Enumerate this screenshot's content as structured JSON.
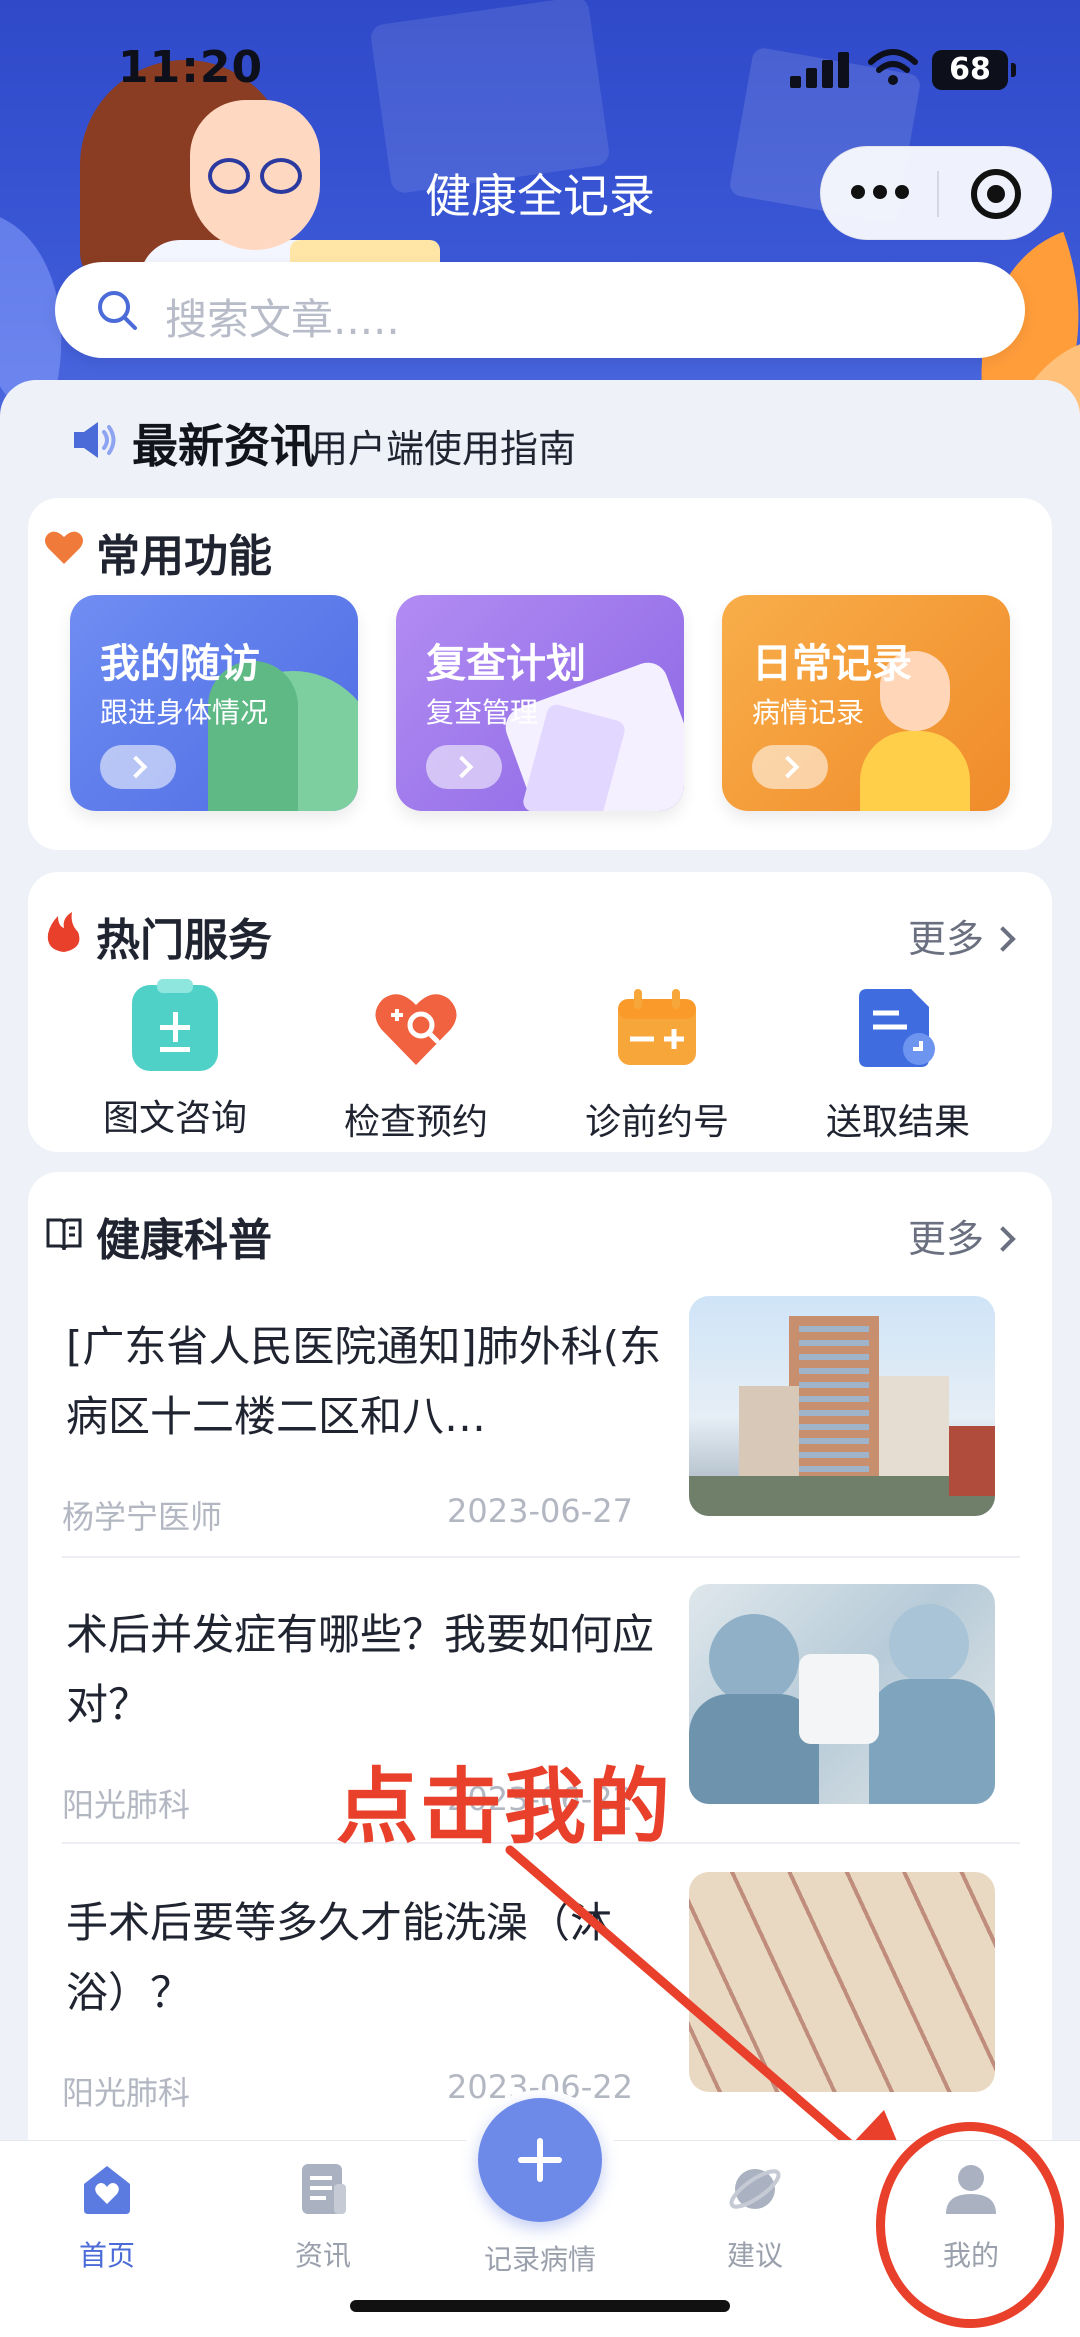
{
  "status": {
    "time": "11:20",
    "battery": "68"
  },
  "header": {
    "title": "健康全记录",
    "search_placeholder": "搜索文章....."
  },
  "news": {
    "label": "最新资讯",
    "text": "用户端使用指南"
  },
  "common": {
    "title": "常用功能",
    "tiles": [
      {
        "title": "我的随访",
        "sub": "跟进身体情况"
      },
      {
        "title": "复查计划",
        "sub": "复查管理"
      },
      {
        "title": "日常记录",
        "sub": "病情记录"
      }
    ]
  },
  "hot": {
    "title": "热门服务",
    "more": "更多",
    "items": [
      {
        "label": "图文咨询"
      },
      {
        "label": "检查预约"
      },
      {
        "label": "诊前约号"
      },
      {
        "label": "送取结果"
      }
    ]
  },
  "science": {
    "title": "健康科普",
    "more": "更多",
    "articles": [
      {
        "title": "[广东省人民医院通知]肺外科(东病区十二楼二区和八…",
        "author": "杨学宁医师",
        "date": "2023-06-27"
      },
      {
        "title": "术后并发症有哪些？我要如何应对？",
        "author": "阳光肺科",
        "date": "2023-06-22"
      },
      {
        "title": "手术后要等多久才能洗澡（沐浴）？",
        "author": "阳光肺科",
        "date": "2023-06-22"
      }
    ]
  },
  "annotation": {
    "text": "点击我的"
  },
  "tabs": {
    "home": "首页",
    "news": "资讯",
    "record": "记录病情",
    "advice": "建议",
    "mine": "我的"
  },
  "colors": {
    "primary": "#3a57d6",
    "accent_red": "#e8402a",
    "tab_active": "#4b6bd8"
  }
}
